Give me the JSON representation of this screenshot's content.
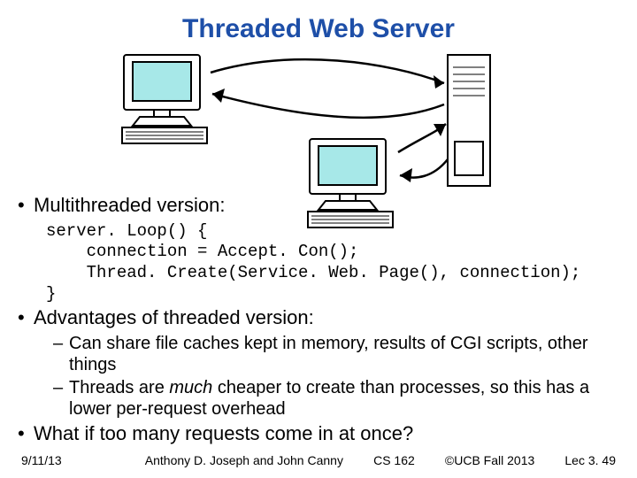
{
  "title": "Threaded Web Server",
  "diagram": {
    "clients": 2,
    "servers": 1,
    "connections": "bidirectional"
  },
  "bullets": {
    "b1": "Multithreaded version:",
    "code_l1": "server. Loop() {",
    "code_l2": "    connection = Accept. Con();",
    "code_l3": "    Thread. Create(Service. Web. Page(), connection);",
    "code_l4": "}",
    "b2": "Advantages of threaded version:",
    "s2a": "Can share file caches kept in memory, results of CGI scripts, other things",
    "s2b_pre": "Threads are ",
    "s2b_em": "much",
    "s2b_post": " cheaper to create than processes, so this has a lower per-request overhead",
    "b3": "What if too many requests come in at once?"
  },
  "footer": {
    "date": "9/11/13",
    "authors": "Anthony D. Joseph and John Canny",
    "course": "CS 162",
    "copyright": "©UCB Fall 2013",
    "lecture": "Lec 3. 49"
  }
}
